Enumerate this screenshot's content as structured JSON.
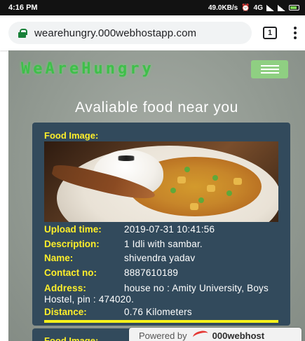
{
  "status_bar": {
    "time": "4:16 PM",
    "right_text": "49.0KB/s",
    "network": "4G"
  },
  "browser": {
    "url": "wearehungry.000webhostapp.com",
    "tab_count": "1"
  },
  "site": {
    "logo": "WeAreHungry",
    "heading": "Avaliable food near you"
  },
  "card": {
    "image_label": "Food Image:",
    "fields": [
      {
        "label": "Upload time:",
        "value": "2019-07-31 10:41:56"
      },
      {
        "label": "Description:",
        "value": "1 Idli with sambar."
      },
      {
        "label": "Name:",
        "value": "shivendra yadav"
      },
      {
        "label": "Contact no:",
        "value": "8887610189"
      }
    ],
    "address_label": "Address:",
    "address_value": "house no : Amity University, Boys Hostel, pin : 474020.",
    "distance_label": "Distance:",
    "distance_value": "0.76 Kilometers"
  },
  "card2": {
    "image_label": "Food Image:"
  },
  "footer": {
    "powered_by": "Powered by",
    "host": "000webhost"
  },
  "colors": {
    "label": "#ffef2a",
    "card_bg": "#324a5c",
    "logo": "#3fbf4a",
    "menu_button": "#8fcf82"
  }
}
